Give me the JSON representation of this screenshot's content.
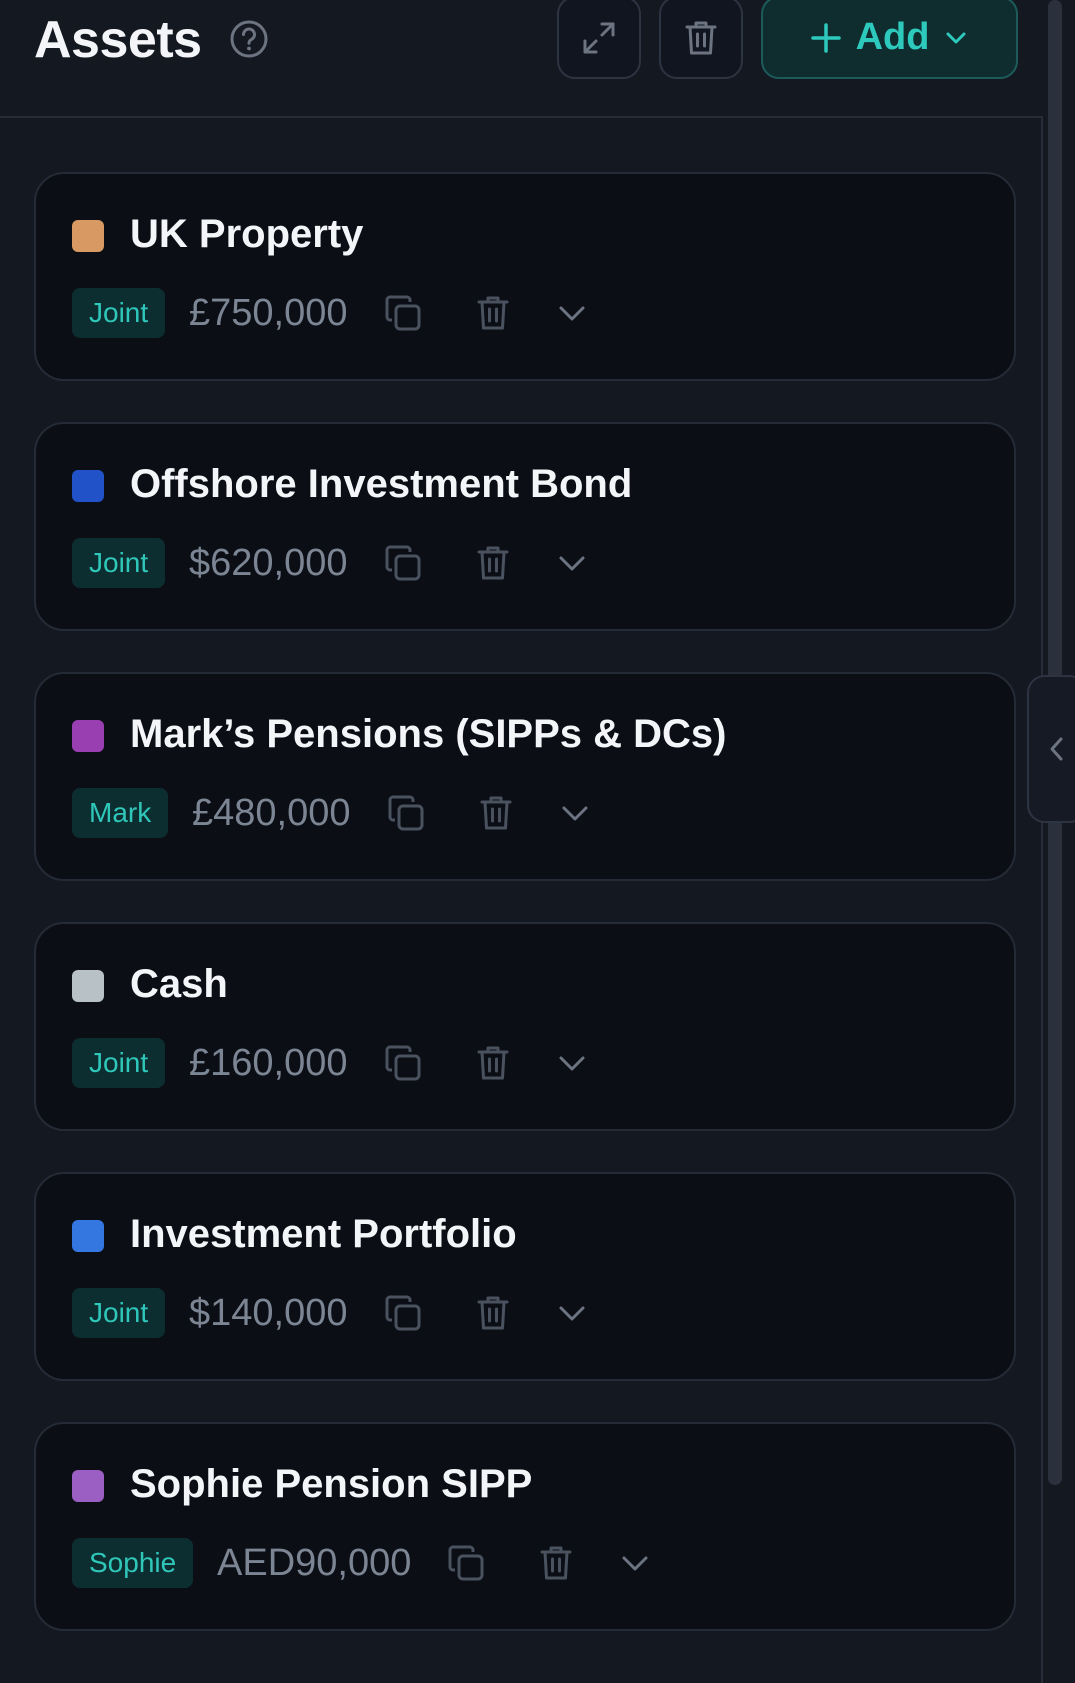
{
  "header": {
    "title": "Assets",
    "add_label": "Add"
  },
  "colors": {
    "accent": "#2ec9bd",
    "card_bg": "#0b0e14",
    "panel_bg": "#141821"
  },
  "assets": [
    {
      "name": "UK Property",
      "owner": "Joint",
      "value": "£750,000",
      "color": "#d89a62"
    },
    {
      "name": "Offshore Investment Bond",
      "owner": "Joint",
      "value": "$620,000",
      "color": "#2152c7"
    },
    {
      "name": "Mark’s Pensions (SIPPs & DCs)",
      "owner": "Mark",
      "value": "£480,000",
      "color": "#9a3fb2"
    },
    {
      "name": "Cash",
      "owner": "Joint",
      "value": "£160,000",
      "color": "#b8c1c6"
    },
    {
      "name": "Investment Portfolio",
      "owner": "Joint",
      "value": "$140,000",
      "color": "#3577e0"
    },
    {
      "name": "Sophie Pension SIPP",
      "owner": "Sophie",
      "value": "AED90,000",
      "color": "#9b5fc4"
    }
  ]
}
